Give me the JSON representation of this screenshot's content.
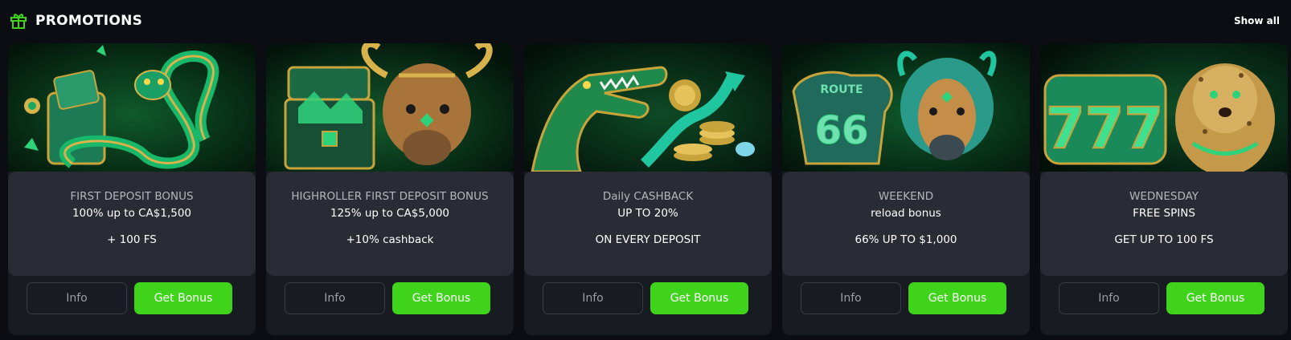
{
  "header": {
    "icon": "gift-icon",
    "title": "PROMOTIONS",
    "show_all": "Show all"
  },
  "colors": {
    "accent_green": "#3fd31c",
    "card_bg": "#191b22",
    "panel_bg": "#2a2c35",
    "page_bg": "#0c0d12"
  },
  "promotions": [
    {
      "art": "snake-wallet-illustration",
      "line1": "FIRST DEPOSIT BONUS",
      "line2": "100% up to CA$1,500",
      "line3": "+ 100 FS",
      "info_label": "Info",
      "bonus_label": "Get Bonus"
    },
    {
      "art": "bull-treasure-illustration",
      "line1": "HIGHROLLER FIRST DEPOSIT BONUS",
      "line2": "125% up to CA$5,000",
      "line3": "+10% cashback",
      "info_label": "Info",
      "bonus_label": "Get Bonus"
    },
    {
      "art": "crocodile-coins-illustration",
      "line1": "Daily CASHBACK",
      "line2": "UP TO 20%",
      "line3": "ON EVERY DEPOSIT",
      "info_label": "Info",
      "bonus_label": "Get Bonus"
    },
    {
      "art": "bison-route66-illustration",
      "art_text_top": "ROUTE",
      "art_text_num": "66",
      "line1": "WEEKEND",
      "line2": "reload bonus",
      "line3": "66% UP TO $1,000",
      "info_label": "Info",
      "bonus_label": "Get Bonus"
    },
    {
      "art": "leopard-slot-illustration",
      "art_text_num": "777",
      "line1": "WEDNESDAY",
      "line2": "FREE SPINS",
      "line3": "GET UP TO 100 FS",
      "info_label": "Info",
      "bonus_label": "Get Bonus"
    }
  ]
}
